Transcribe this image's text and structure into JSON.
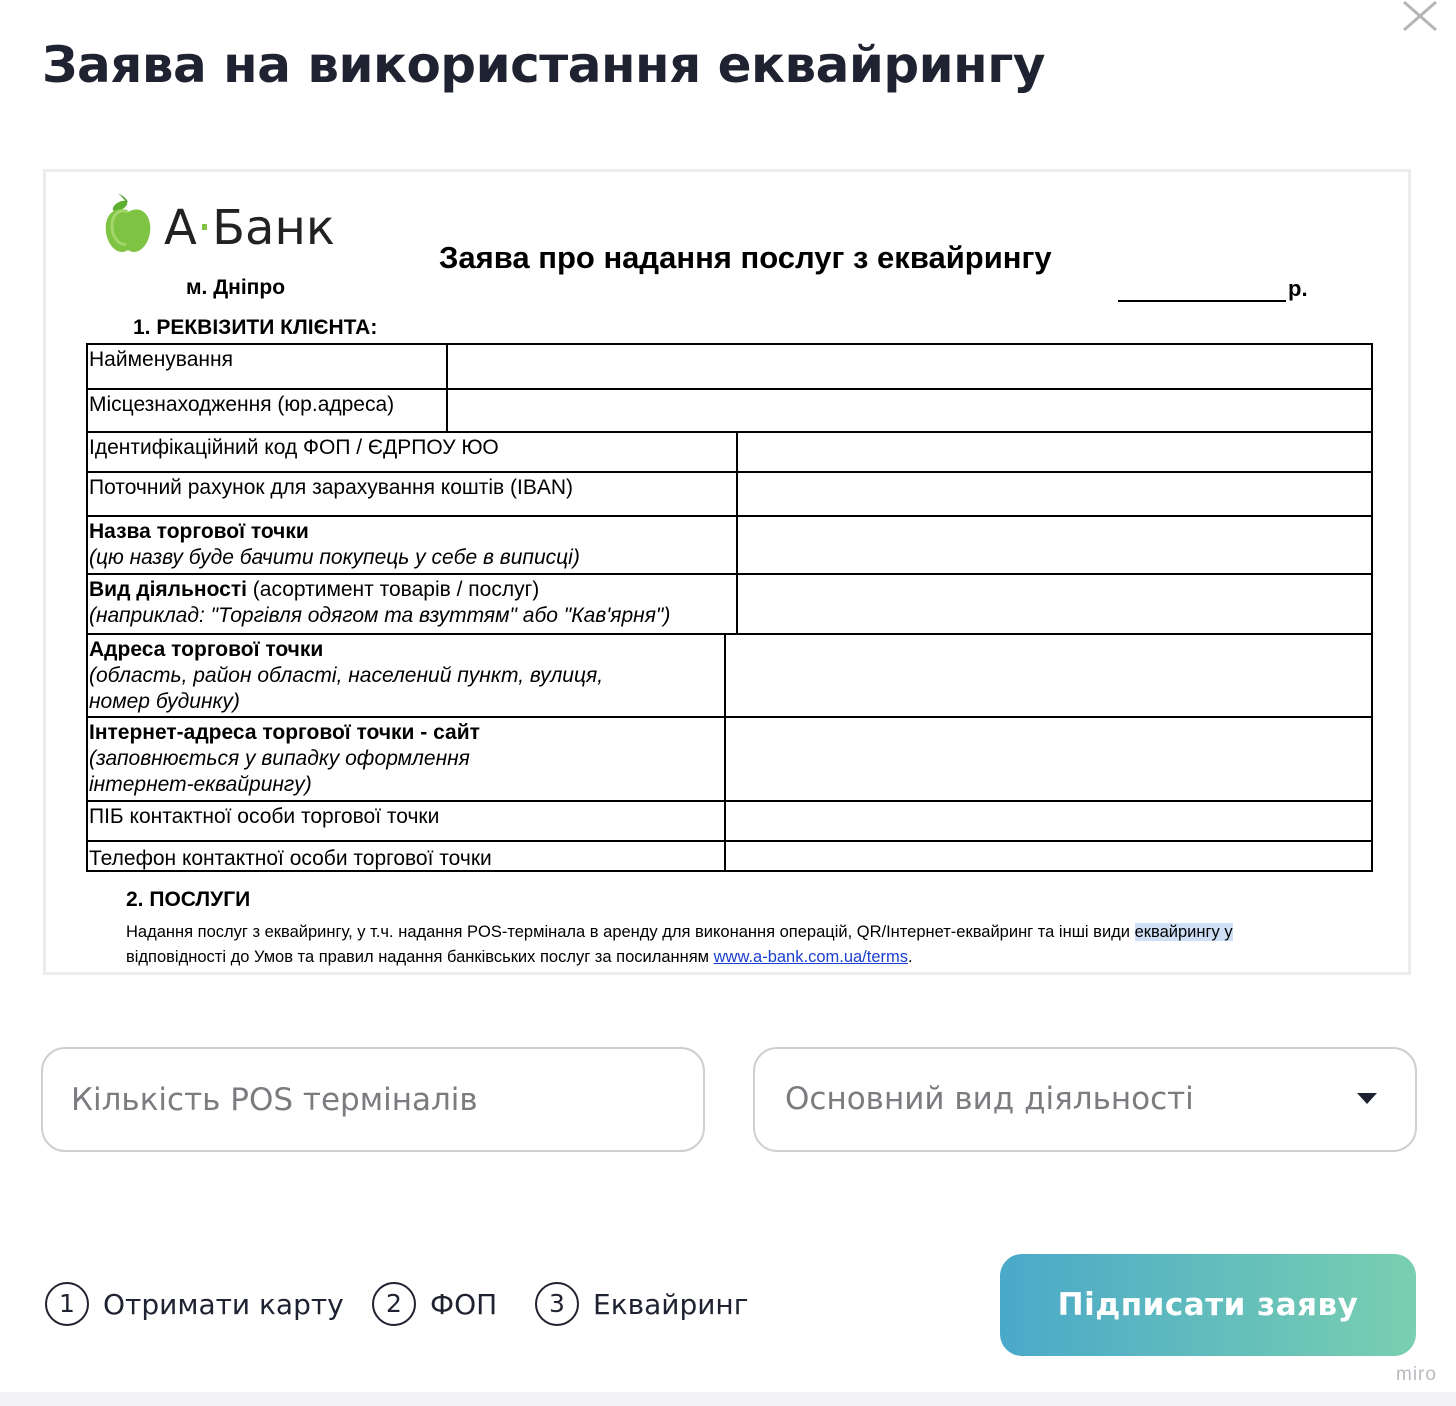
{
  "modal": {
    "title": "Заява на використання еквайрингу",
    "close_icon": "close-icon"
  },
  "document": {
    "logo": {
      "text": "А·Банк",
      "left": "А",
      "dot": "·",
      "right": "Банк",
      "icon": "apple-icon"
    },
    "city": "м. Дніпро",
    "title": "Заява про надання послуг з еквайрингу",
    "date_suffix": "р.",
    "section1_title": "1. РЕКВІЗИТИ КЛІЄНТА:",
    "rows": [
      {
        "label": "Найменування"
      },
      {
        "label": "Місцезнаходження (юр.адреса)"
      },
      {
        "label": "Ідентифікаційний код ФОП / ЄДРПОУ ЮО"
      },
      {
        "label": "Поточний рахунок для зарахування коштів (IBAN)"
      },
      {
        "label_bold": "Назва торгової точки",
        "hint": "(цю назву буде бачити покупець у себе в виписці)"
      },
      {
        "label_bold": "Вид діяльності",
        "label_rest": " (асортимент товарів / послуг)",
        "hint": "(наприклад: \"Торгівля одягом та взуттям\" або \"Кав'ярня\")"
      },
      {
        "label_bold": "Адреса торгової точки",
        "hint_1": "(область, район області, населений пункт, вулиця,",
        "hint_2": "номер будинку)"
      },
      {
        "label_bold": "Інтернет-адреса торгової точки - сайт",
        "hint_1": "(заповнюється у випадку оформлення",
        "hint_2": "інтернет-еквайрингу)"
      },
      {
        "label": "ПІБ контактної особи торгової точки"
      },
      {
        "label": "Телефон контактної особи торгової точки"
      }
    ],
    "section2_title": "2. ПОСЛУГИ",
    "section2_text_1": "Надання послуг з еквайрингу, у т.ч. надання POS-термінала в аренду для виконання операцій, QR/Інтернет-еквайринг та інші види ",
    "section2_text_highlight": "еквайрингу у",
    "section2_text_2": "відповідності до Умов та правил надання банківських послуг за посиланням ",
    "section2_link": "www.a-bank.com.ua/terms",
    "section2_text_end": "."
  },
  "form": {
    "pos_count": {
      "placeholder": "Кількість POS терміналів",
      "value": ""
    },
    "activity_select": {
      "placeholder": "Основний вид діяльності",
      "icon": "chevron-down-icon"
    }
  },
  "steps": [
    {
      "number": "1",
      "label": "Отримати карту"
    },
    {
      "number": "2",
      "label": "ФОП"
    },
    {
      "number": "3",
      "label": "Еквайринг"
    }
  ],
  "submit_label": "Підписати заяву",
  "watermark": "miro",
  "colors": {
    "accent_start": "#4aa9c9",
    "accent_end": "#79cfb0",
    "logo_green": "#7fc342",
    "link": "#1a3fd0"
  }
}
